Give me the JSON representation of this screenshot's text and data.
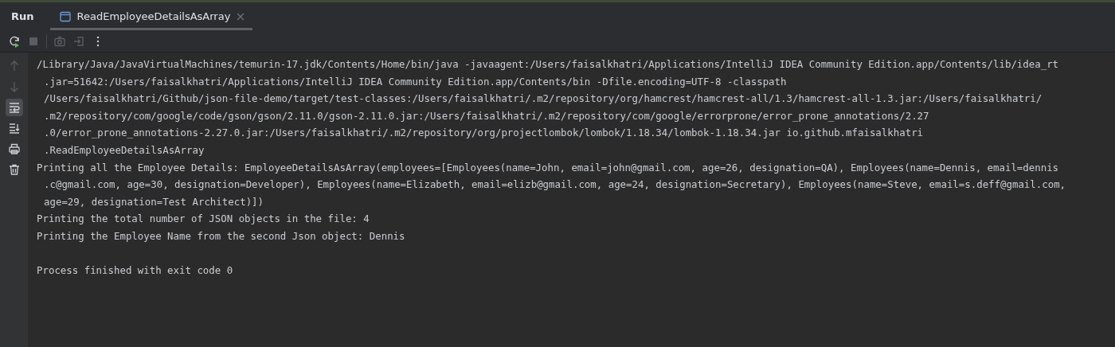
{
  "panel": {
    "title": "Run",
    "tabs": [
      {
        "label": "ReadEmployeeDetailsAsArray",
        "selected": true
      }
    ]
  },
  "toolbar": [
    {
      "kind": "rerun",
      "disabled": false
    },
    {
      "kind": "stop",
      "disabled": true
    },
    {
      "kind": "camera",
      "disabled": true
    },
    {
      "kind": "exit",
      "disabled": true
    },
    {
      "kind": "more",
      "disabled": false
    }
  ],
  "gutter": [
    {
      "kind": "up",
      "disabled": true,
      "selected": false
    },
    {
      "kind": "down",
      "disabled": true,
      "selected": false
    },
    {
      "kind": "wrap",
      "disabled": false,
      "selected": true
    },
    {
      "kind": "scroll-end",
      "disabled": false,
      "selected": false
    },
    {
      "kind": "print",
      "disabled": false,
      "selected": false
    },
    {
      "kind": "trash",
      "disabled": false,
      "selected": false
    }
  ],
  "console": [
    {
      "kind": "start",
      "text": "/Library/Java/JavaVirtualMachines/temurin-17.jdk/Contents/Home/bin/java -javaagent:/Users/faisalkhatri/Applications/IntelliJ IDEA Community Edition.app/Contents/lib/idea_rt"
    },
    {
      "kind": "wrap",
      "text": ".jar=51642:/Users/faisalkhatri/Applications/IntelliJ IDEA Community Edition.app/Contents/bin -Dfile.encoding=UTF-8 -classpath"
    },
    {
      "kind": "wrap",
      "text": "/Users/faisalkhatri/Github/json-file-demo/target/test-classes:/Users/faisalkhatri/.m2/repository/org/hamcrest/hamcrest-all/1.3/hamcrest-all-1.3.jar:/Users/faisalkhatri/"
    },
    {
      "kind": "wrap",
      "text": ".m2/repository/com/google/code/gson/gson/2.11.0/gson-2.11.0.jar:/Users/faisalkhatri/.m2/repository/com/google/errorprone/error_prone_annotations/2.27"
    },
    {
      "kind": "wrap",
      "text": ".0/error_prone_annotations-2.27.0.jar:/Users/faisalkhatri/.m2/repository/org/projectlombok/lombok/1.18.34/lombok-1.18.34.jar io.github.mfaisalkhatri"
    },
    {
      "kind": "wrap",
      "text": ".ReadEmployeeDetailsAsArray"
    },
    {
      "kind": "start",
      "text": "Printing all the Employee Details: EmployeeDetailsAsArray(employees=[Employees(name=John, email=john@gmail.com, age=26, designation=QA), Employees(name=Dennis, email=dennis"
    },
    {
      "kind": "wrap",
      "text": ".c@gmail.com, age=30, designation=Developer), Employees(name=Elizabeth, email=elizb@gmail.com, age=24, designation=Secretary), Employees(name=Steve, email=s.deff@gmail.com,"
    },
    {
      "kind": "wrap",
      "text": "age=29, designation=Test Architect)])"
    },
    {
      "kind": "start",
      "text": "Printing the total number of JSON objects in the file: 4"
    },
    {
      "kind": "start",
      "text": "Printing the Employee Name from the second Json object: Dennis"
    },
    {
      "kind": "blank"
    },
    {
      "kind": "start",
      "text": "Process finished with exit code 0"
    }
  ]
}
